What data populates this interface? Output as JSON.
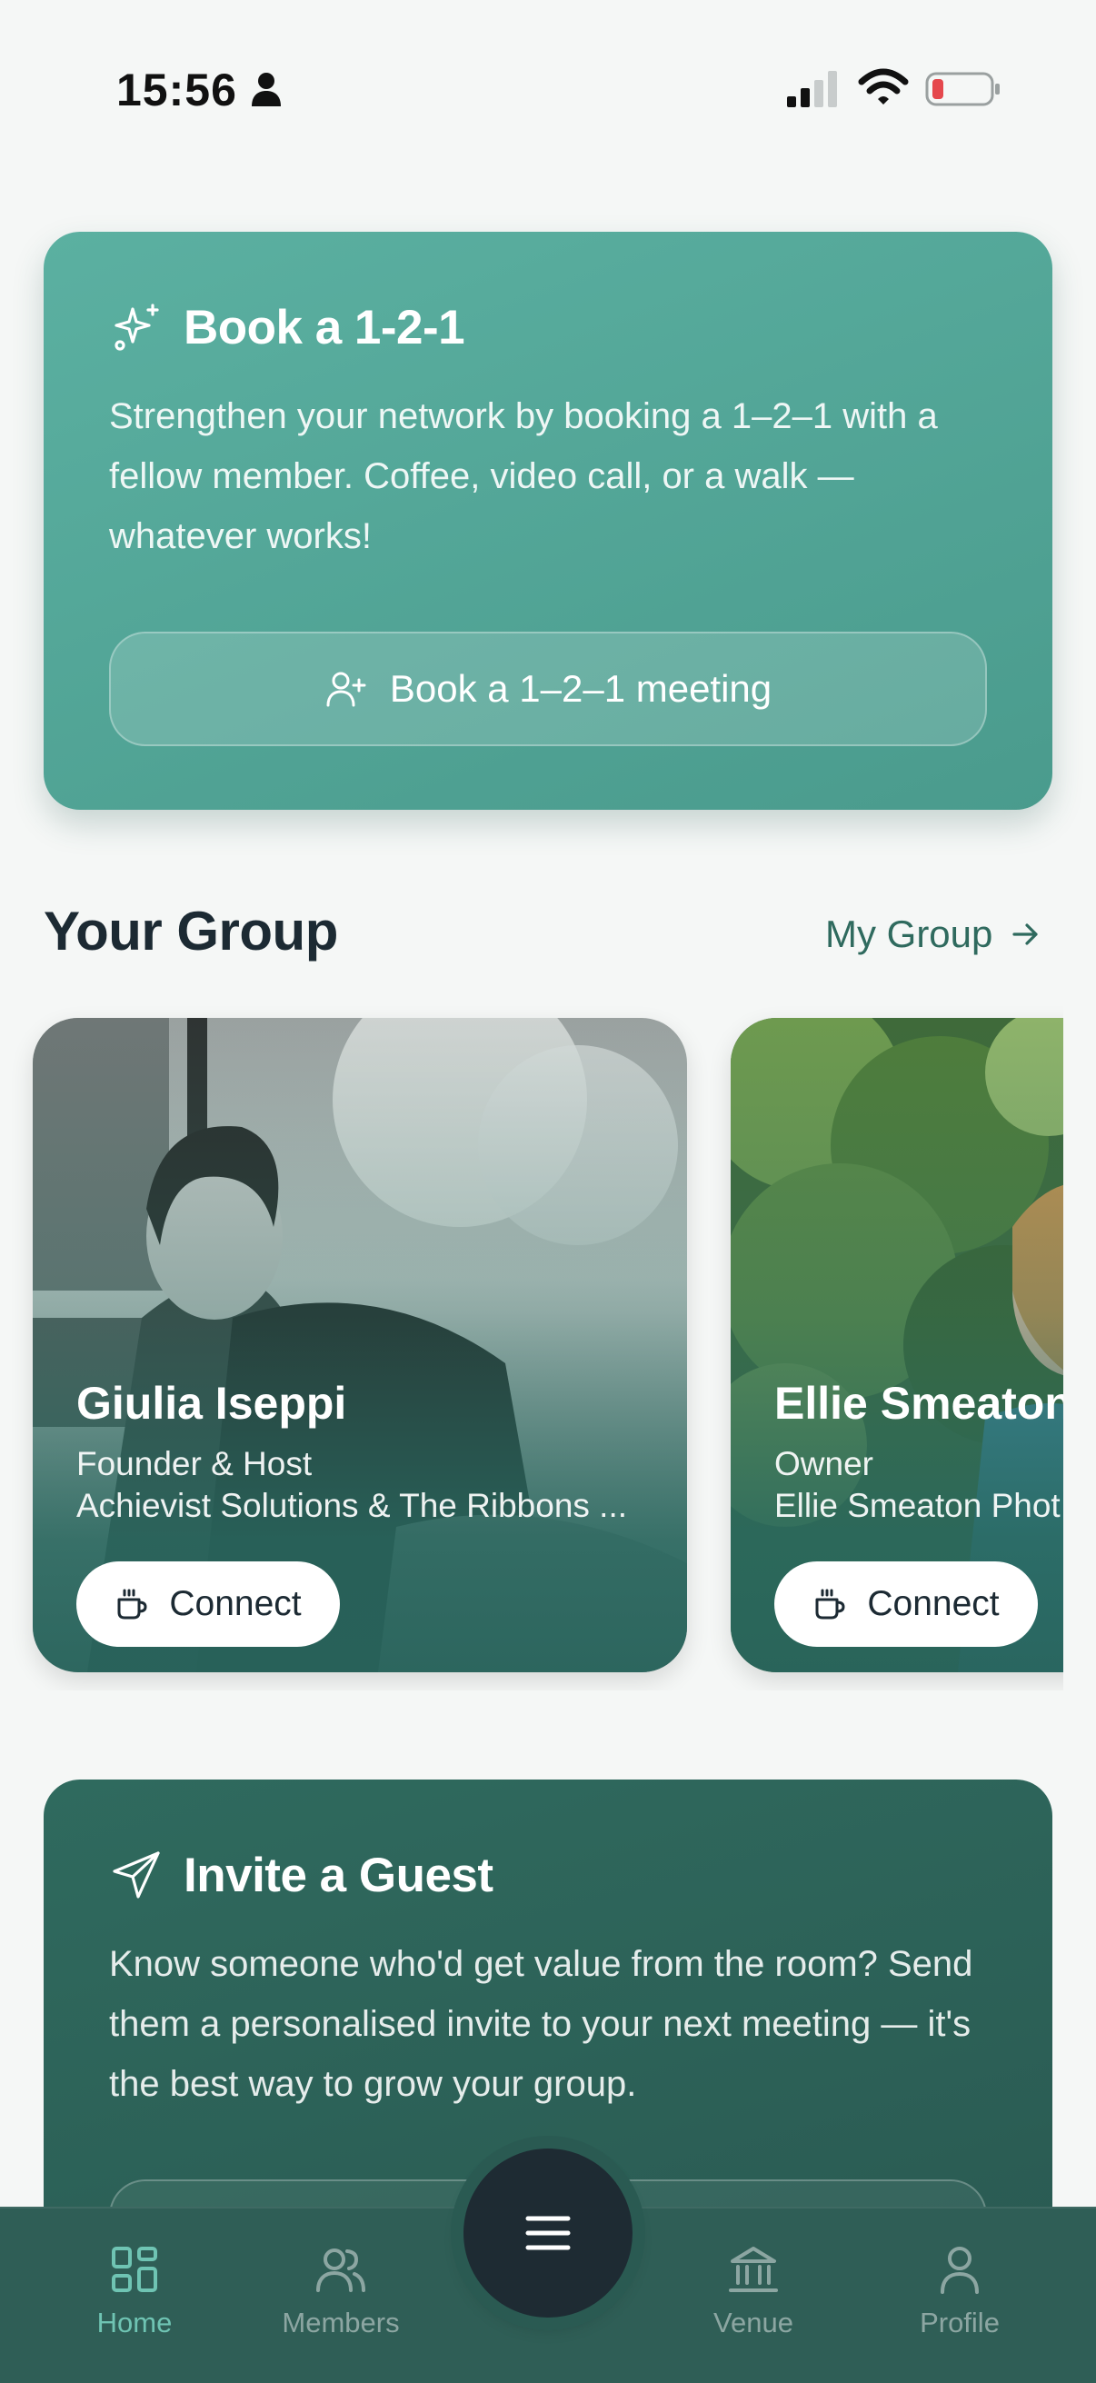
{
  "status_bar": {
    "time": "15:56"
  },
  "book_card": {
    "title": "Book a 1-2-1",
    "description": "Strengthen your network by booking a 1–2–1 with a fellow member. Coffee, video call, or a walk — whatever works!",
    "button_label": "Book a 1–2–1 meeting"
  },
  "group": {
    "title": "Your Group",
    "link_label": "My Group",
    "members": [
      {
        "name": "Giulia Iseppi",
        "role": "Founder & Host",
        "company": "Achievist Solutions & The Ribbons ...",
        "connect_label": "Connect"
      },
      {
        "name": "Ellie Smeaton",
        "role": "Owner",
        "company": "Ellie Smeaton Phot",
        "connect_label": "Connect"
      }
    ]
  },
  "invite_card": {
    "title": "Invite a Guest",
    "description": "Know someone who'd get value from the room? Send them a personalised invite to your next meeting — it's the best way to grow your group."
  },
  "nav": {
    "items": [
      {
        "label": "Home",
        "icon": "home-grid-icon",
        "active": true
      },
      {
        "label": "Members",
        "icon": "users-icon",
        "active": false
      },
      {
        "label": "Venue",
        "icon": "venue-building-icon",
        "active": false
      },
      {
        "label": "Profile",
        "icon": "profile-icon",
        "active": false
      }
    ],
    "center_icon": "menu-icon"
  },
  "colors": {
    "book_card": "#55a898",
    "invite_card": "#2d6358",
    "nav_bg": "#2f5e56",
    "nav_active": "#6fc4b3",
    "accent_text": "#2f6a5e",
    "battery_low": "#e5484d"
  }
}
